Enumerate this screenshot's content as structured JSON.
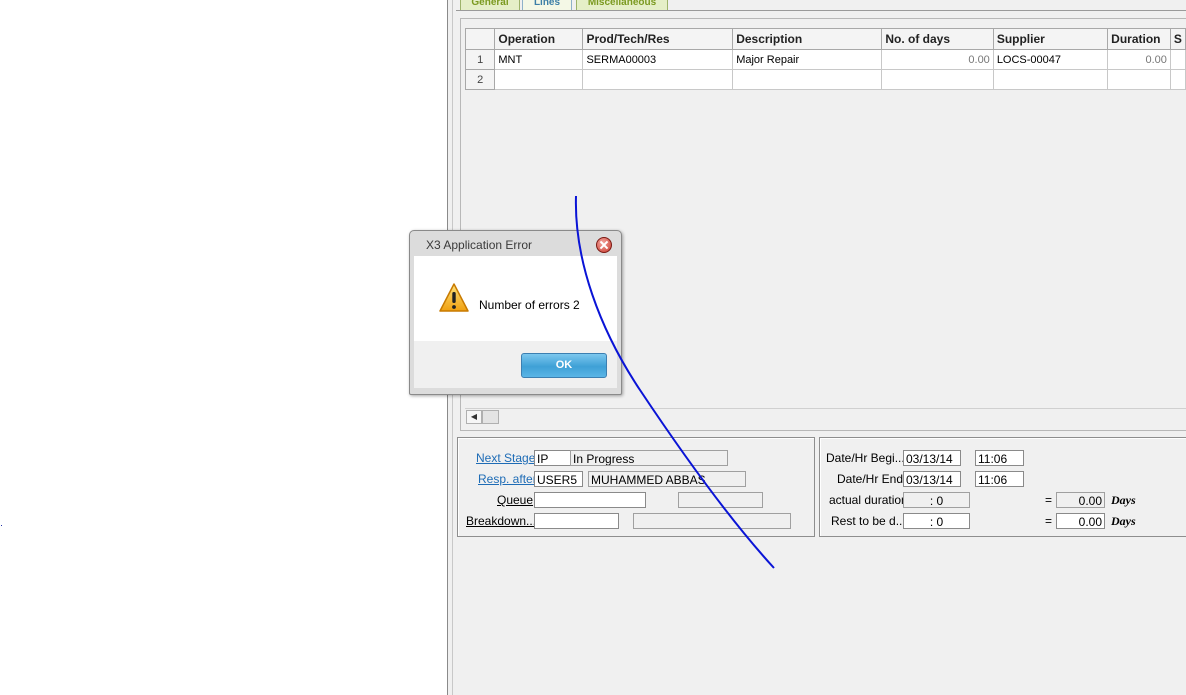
{
  "tabs": [
    {
      "label": "General"
    },
    {
      "label": "Lines"
    },
    {
      "label": "Miscellaneous"
    }
  ],
  "grid": {
    "columns": [
      "Operation",
      "Prod/Tech/Res",
      "Description",
      "No. of days",
      "Supplier",
      "Duration",
      "S"
    ],
    "rows": [
      {
        "num": "1",
        "operation": "MNT",
        "prod": "SERMA00003",
        "description": "Major Repair",
        "days": "0.00",
        "supplier": "LOCS-00047",
        "duration": "0.00",
        "s": ""
      },
      {
        "num": "2",
        "operation": "",
        "prod": "",
        "description": "",
        "days": "",
        "supplier": "",
        "duration": "",
        "s": ""
      }
    ]
  },
  "stage_panel": {
    "next_stage_label": "Next Stage",
    "next_stage_code": "IP",
    "next_stage_desc": "In Progress",
    "resp_after_label": "Resp. after",
    "resp_after_code": "USER5",
    "resp_after_name": "MUHAMMED ABBAS",
    "queue_label": "Queue",
    "queue_value": "",
    "queue_desc": "",
    "breakdown_label": "Breakdown...",
    "breakdown_value": "",
    "breakdown_desc": ""
  },
  "date_panel": {
    "begin_label": "Date/Hr Begi...",
    "begin_date": "03/13/14",
    "begin_time": "11:06",
    "end_label": "Date/Hr End",
    "end_date": "03/13/14",
    "end_time": "11:06",
    "actual_label": "actual duration",
    "actual_value": ": 0",
    "actual_days": "0.00",
    "rest_label": "Rest to be d...",
    "rest_value": ": 0",
    "rest_days": "0.00",
    "days_unit": "Days",
    "equals": "="
  },
  "dialog": {
    "title": "X3 Application Error",
    "message": "Number of errors 2",
    "ok_label": "OK",
    "icon": "warning-icon"
  },
  "colors": {
    "link": "#1e6cb6",
    "ok_button": "#3fa0d6",
    "annotation_stroke": "#0a14d6"
  }
}
